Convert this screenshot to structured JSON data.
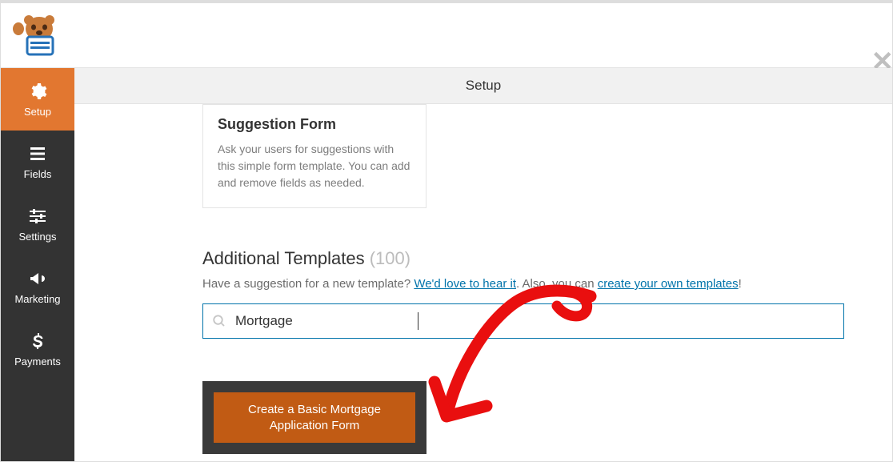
{
  "header": {
    "tab_label": "Setup"
  },
  "sidebar": {
    "items": [
      {
        "id": "setup",
        "label": "Setup",
        "active": true
      },
      {
        "id": "fields",
        "label": "Fields",
        "active": false
      },
      {
        "id": "settings",
        "label": "Settings",
        "active": false
      },
      {
        "id": "marketing",
        "label": "Marketing",
        "active": false
      },
      {
        "id": "payments",
        "label": "Payments",
        "active": false
      }
    ]
  },
  "card": {
    "title": "Suggestion Form",
    "desc": "Ask your users for suggestions with this simple form template. You can add and remove fields as needed."
  },
  "section": {
    "title": "Additional Templates",
    "count": "(100)",
    "sub_prefix": "Have a suggestion for a new template? ",
    "link1": "We'd love to hear it",
    "sub_mid": ". Also, you can ",
    "link2": "create your own templates",
    "sub_suffix": "!"
  },
  "search": {
    "value": "Mortgage",
    "placeholder": ""
  },
  "result": {
    "button": "Create a Basic Mortgage Application Form"
  }
}
